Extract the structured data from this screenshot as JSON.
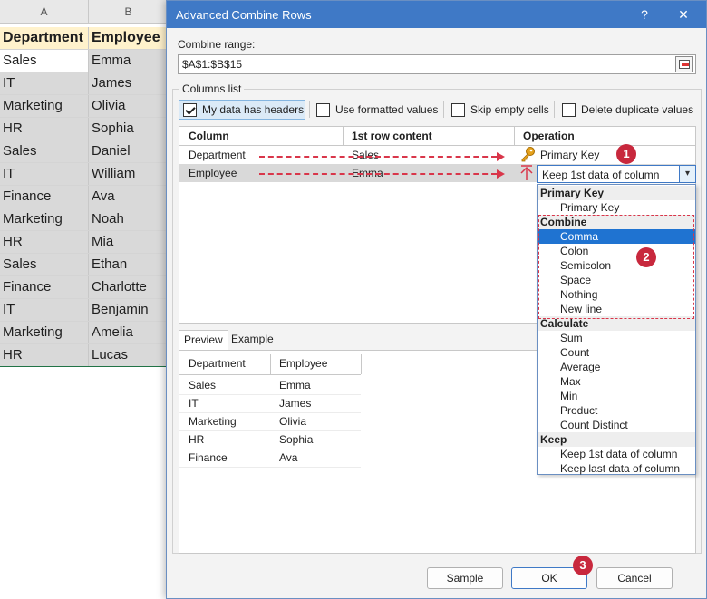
{
  "sheet": {
    "col_a": "A",
    "col_b": "B",
    "rows": [
      [
        "Department",
        "Employee"
      ],
      [
        "Sales",
        "Emma"
      ],
      [
        "IT",
        "James"
      ],
      [
        "Marketing",
        "Olivia"
      ],
      [
        "HR",
        "Sophia"
      ],
      [
        "Sales",
        "Daniel"
      ],
      [
        "IT",
        "William"
      ],
      [
        "Finance",
        "Ava"
      ],
      [
        "Marketing",
        "Noah"
      ],
      [
        "HR",
        "Mia"
      ],
      [
        "Sales",
        "Ethan"
      ],
      [
        "Finance",
        "Charlotte"
      ],
      [
        "IT",
        "Benjamin"
      ],
      [
        "Marketing",
        "Amelia"
      ],
      [
        "HR",
        "Lucas"
      ]
    ]
  },
  "dialog": {
    "title": "Advanced Combine Rows",
    "help": "?",
    "close": "✕",
    "combine_range_label": "Combine range:",
    "combine_range_value": "$A$1:$B$15",
    "columns_list_label": "Columns list",
    "checkboxes": {
      "headers": {
        "label": "My data has headers",
        "checked": true
      },
      "formatted": {
        "label": "Use formatted values",
        "checked": false
      },
      "skip_empty": {
        "label": "Skip empty cells",
        "checked": false
      },
      "dedupe": {
        "label": "Delete duplicate values",
        "checked": false
      }
    },
    "table": {
      "headers": [
        "Column",
        "1st row content",
        "Operation"
      ],
      "rows": [
        {
          "column": "Department",
          "first": "Sales",
          "operation": "Primary Key"
        },
        {
          "column": "Employee",
          "first": "Emma",
          "operation": "Keep 1st data of column"
        }
      ]
    },
    "dropdown": {
      "items": [
        {
          "type": "group",
          "label": "Primary Key"
        },
        {
          "type": "opt",
          "label": "Primary Key"
        },
        {
          "type": "group",
          "label": "Combine"
        },
        {
          "type": "opt",
          "label": "Comma",
          "highlighted": true
        },
        {
          "type": "opt",
          "label": "Colon"
        },
        {
          "type": "opt",
          "label": "Semicolon"
        },
        {
          "type": "opt",
          "label": "Space"
        },
        {
          "type": "opt",
          "label": "Nothing"
        },
        {
          "type": "opt",
          "label": "New line"
        },
        {
          "type": "group",
          "label": "Calculate"
        },
        {
          "type": "opt",
          "label": "Sum"
        },
        {
          "type": "opt",
          "label": "Count"
        },
        {
          "type": "opt",
          "label": "Average"
        },
        {
          "type": "opt",
          "label": "Max"
        },
        {
          "type": "opt",
          "label": "Min"
        },
        {
          "type": "opt",
          "label": "Product"
        },
        {
          "type": "opt",
          "label": "Count Distinct"
        },
        {
          "type": "group",
          "label": "Keep"
        },
        {
          "type": "opt",
          "label": "Keep 1st data of column"
        },
        {
          "type": "opt",
          "label": "Keep last data of column"
        }
      ]
    },
    "preview": {
      "tabs": [
        "Preview",
        "Example"
      ],
      "headers": [
        "Department",
        "Employee"
      ],
      "rows": [
        [
          "Sales",
          "Emma"
        ],
        [
          "IT",
          "James"
        ],
        [
          "Marketing",
          "Olivia"
        ],
        [
          "HR",
          "Sophia"
        ],
        [
          "Finance",
          "Ava"
        ]
      ]
    },
    "buttons": {
      "sample": "Sample",
      "ok": "OK",
      "cancel": "Cancel"
    },
    "badges": [
      "1",
      "2",
      "3"
    ]
  },
  "colors": {
    "titlebar": "#3f79c6",
    "highlight": "#1f73d1",
    "annotation_red": "#d9364a",
    "badge_red": "#c8283d",
    "sheet_header_fill": "#fff2cc"
  }
}
